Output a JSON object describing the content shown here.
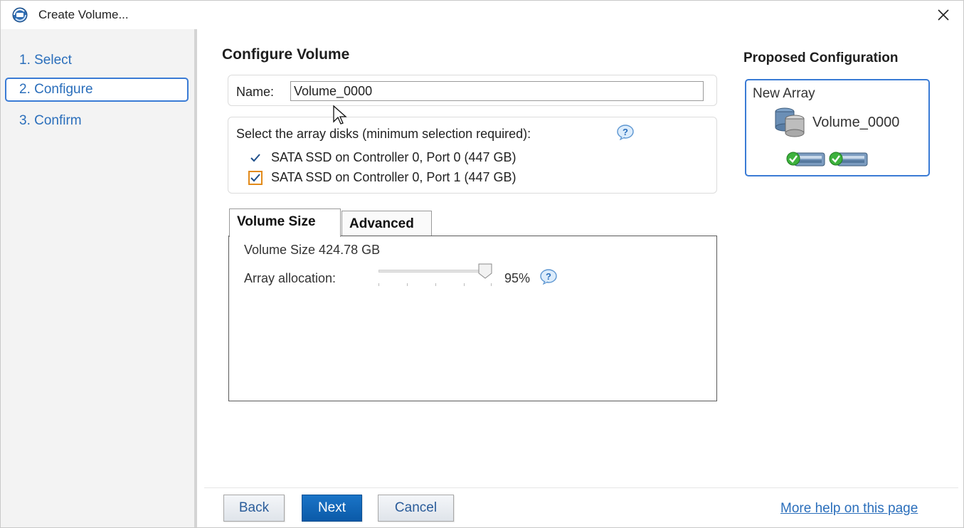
{
  "window": {
    "title": "Create Volume...",
    "close_icon": "close-icon",
    "app_icon": "intel-rst-icon"
  },
  "sidebar": {
    "steps": [
      {
        "label": "1. Select",
        "active": false
      },
      {
        "label": "2. Configure",
        "active": true
      },
      {
        "label": "3. Confirm",
        "active": false
      }
    ]
  },
  "main": {
    "heading": "Configure Volume",
    "name": {
      "label": "Name:",
      "value": "Volume_0000"
    },
    "disks": {
      "label": "Select the array disks (minimum selection required):",
      "items": [
        {
          "label": "SATA SSD on Controller 0, Port 0 (447 GB)",
          "checked": true
        },
        {
          "label": "SATA SSD on Controller 0, Port 1 (447 GB)",
          "checked": true
        }
      ]
    },
    "tabs": [
      {
        "label": "Volume Size",
        "active": true
      },
      {
        "label": "Advanced",
        "active": false
      }
    ],
    "volume_size": {
      "size_text": "Volume Size 424.78 GB",
      "allocation_label": "Array allocation:",
      "allocation_percent_text": "95%",
      "allocation_fraction": 0.95
    }
  },
  "proposed": {
    "title": "Proposed Configuration",
    "array_label": "New Array",
    "volume_name": "Volume_0000",
    "disk_count": 2
  },
  "footer": {
    "back_label": "Back",
    "next_label": "Next",
    "cancel_label": "Cancel",
    "help_link": "More help on this page"
  },
  "colors": {
    "accent": "#3a7bd5",
    "link": "#2a6ebb",
    "primary_button": "#0b5aa8",
    "focus_outline": "#e28a1a"
  }
}
